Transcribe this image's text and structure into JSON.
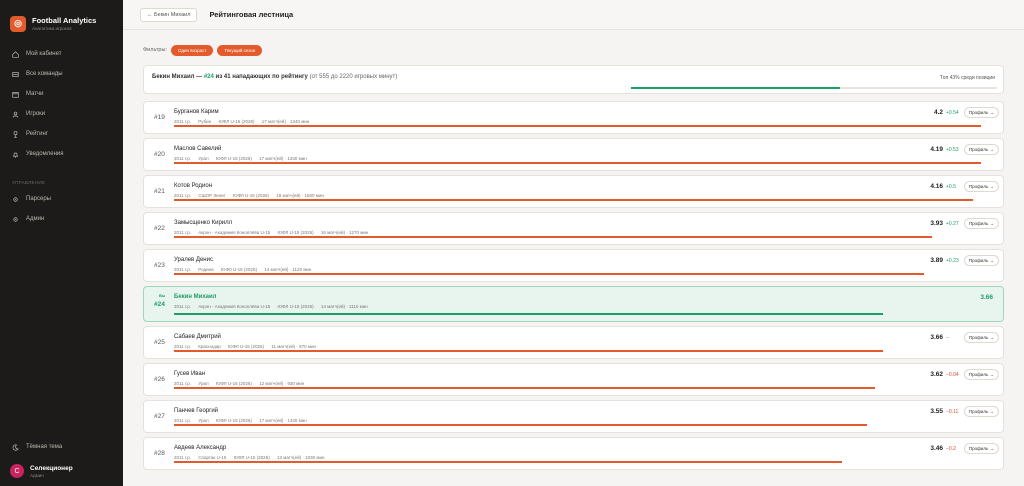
{
  "brand": {
    "title": "Football Analytics",
    "subtitle": "Аналитика игроков"
  },
  "nav": [
    {
      "label": "Мой кабинет",
      "icon": "home-icon"
    },
    {
      "label": "Все команды",
      "icon": "teams-icon"
    },
    {
      "label": "Матчи",
      "icon": "calendar-icon"
    },
    {
      "label": "Игроки",
      "icon": "user-icon"
    },
    {
      "label": "Рейтинг",
      "icon": "trophy-icon"
    },
    {
      "label": "Уведомления",
      "icon": "bell-icon"
    }
  ],
  "nav_section": "УПРАВЛЕНИЕ",
  "nav_admin": [
    {
      "label": "Парсеры",
      "icon": "gear-icon"
    },
    {
      "label": "Админ",
      "icon": "gear-icon"
    }
  ],
  "theme_toggle": "Тёмная тема",
  "user": {
    "name": "Селекционер",
    "role": "Админ",
    "initial": "С"
  },
  "topbar": {
    "back": "← Бекин Михаил",
    "title": "Рейтинговая лестница"
  },
  "filters": {
    "label": "Фильтры:",
    "chips": [
      "Один возраст",
      "Текущий сезон"
    ]
  },
  "summary": {
    "name": "Бекин Михаил —",
    "rank": "#24",
    "rest": "из 41 нападающих по рейтингу",
    "muted": "(от 555 до 2220 игровых минут)",
    "top": "Топ 43% среди позиции",
    "progress": 0.57
  },
  "profile_label": "Профиль →",
  "you_label": "Вы",
  "rows": [
    {
      "rank": "#19",
      "name": "Бурганов Карим",
      "year": "2011 г.р.",
      "team": "Рубин",
      "league": "ЮФЛ U-15 (2026)",
      "matches": "17 матч(ей) · 1340 мин",
      "score": "4.2",
      "delta": "+0.54",
      "sign": "pos",
      "fill": 0.99
    },
    {
      "rank": "#20",
      "name": "Маслов Савелий",
      "year": "2011 г.р.",
      "team": "Урал",
      "league": "ЮФЛ U-15 (2026)",
      "matches": "17 матч(ей) · 1330 мин",
      "score": "4.19",
      "delta": "+0.53",
      "sign": "pos",
      "fill": 0.99
    },
    {
      "rank": "#21",
      "name": "Котов Родион",
      "year": "2011 г.р.",
      "team": "СШОР Зенит",
      "league": "ЮФЛ U-15 (2026)",
      "matches": "19 матч(ей) · 1500 мин",
      "score": "4.16",
      "delta": "+0.5",
      "sign": "pos",
      "fill": 0.98
    },
    {
      "rank": "#22",
      "name": "Замысщенко Кирилл",
      "year": "2011 г.р.",
      "team": "Акрон - Академия Коноплёва U-15",
      "league": "ЮФЛ U-15 (2026)",
      "matches": "16 матч(ей) · 1270 мин",
      "score": "3.93",
      "delta": "+0.27",
      "sign": "pos",
      "fill": 0.93
    },
    {
      "rank": "#23",
      "name": "Уралев Денис",
      "year": "2011 г.р.",
      "team": "Родина",
      "league": "ЮФЛ U-15 (2026)",
      "matches": "14 матч(ей) · 1120 мин",
      "score": "3.89",
      "delta": "+0.23",
      "sign": "pos",
      "fill": 0.92
    },
    {
      "rank": "#24",
      "name": "Бекин Михаил",
      "year": "2011 г.р.",
      "team": "Акрон - Академия Коноплёва U-15",
      "league": "ЮФЛ U-15 (2026)",
      "matches": "14 матч(ей) · 1110 мин",
      "score": "3.66",
      "delta": "",
      "sign": "me",
      "fill": 0.87
    },
    {
      "rank": "#25",
      "name": "Сабаев Дмитрий",
      "year": "2011 г.р.",
      "team": "Краснодар",
      "league": "ЮФЛ U-15 (2026)",
      "matches": "11 матч(ей) · 870 мин",
      "score": "3.66",
      "delta": "–",
      "sign": "neu",
      "fill": 0.87
    },
    {
      "rank": "#26",
      "name": "Гусев Иван",
      "year": "2011 г.р.",
      "team": "Урал",
      "league": "ЮФЛ U-15 (2026)",
      "matches": "12 матч(ей) · 930 мин",
      "score": "3.62",
      "delta": "−0.04",
      "sign": "neg",
      "fill": 0.86
    },
    {
      "rank": "#27",
      "name": "Панчев Георгий",
      "year": "2011 г.р.",
      "team": "Урал",
      "league": "ЮФЛ U-15 (2026)",
      "matches": "17 матч(ей) · 1340 мин",
      "score": "3.55",
      "delta": "−0.11",
      "sign": "neg",
      "fill": 0.85
    },
    {
      "rank": "#28",
      "name": "Авдеев Александр",
      "year": "2011 г.р.",
      "team": "Спартак U-15",
      "league": "ЮФЛ U-15 (2026)",
      "matches": "13 матч(ей) · 1030 мин",
      "score": "3.46",
      "delta": "−0.2",
      "sign": "neg",
      "fill": 0.82
    }
  ]
}
